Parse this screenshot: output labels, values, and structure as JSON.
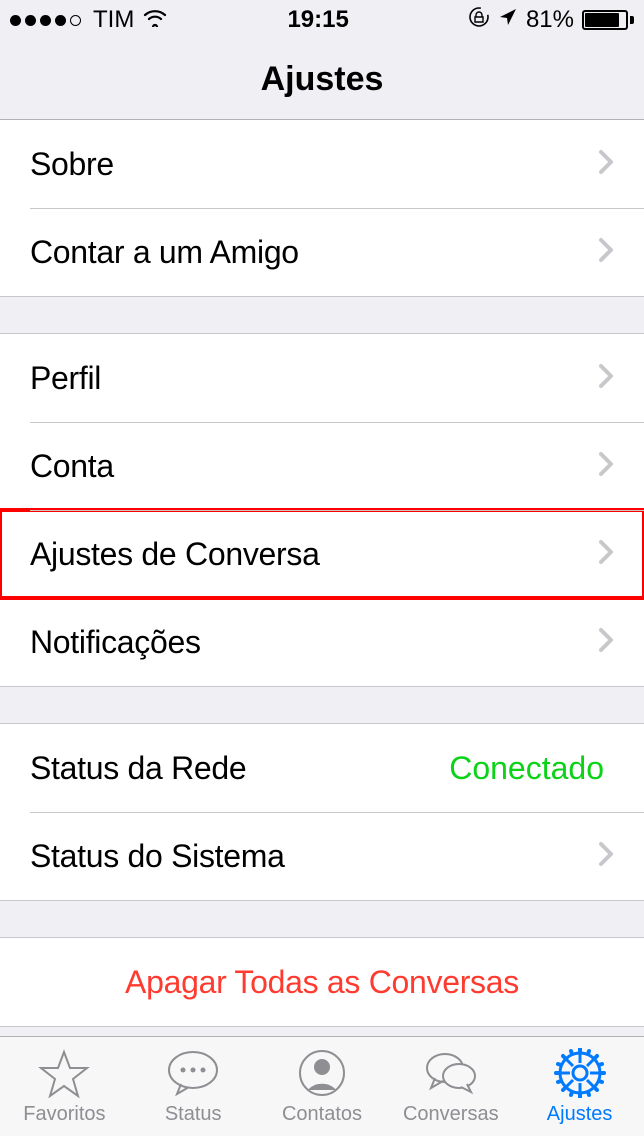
{
  "status_bar": {
    "carrier": "TIM",
    "time": "19:15",
    "battery_pct": "81%"
  },
  "nav": {
    "title": "Ajustes"
  },
  "groups": [
    {
      "rows": [
        {
          "id": "sobre",
          "label": "Sobre",
          "chevron": true
        },
        {
          "id": "contar-amigo",
          "label": "Contar a um Amigo",
          "chevron": true
        }
      ]
    },
    {
      "rows": [
        {
          "id": "perfil",
          "label": "Perfil",
          "chevron": true
        },
        {
          "id": "conta",
          "label": "Conta",
          "chevron": true
        },
        {
          "id": "ajustes-conversa",
          "label": "Ajustes de Conversa",
          "chevron": true,
          "highlight": true
        },
        {
          "id": "notificacoes",
          "label": "Notificações",
          "chevron": true
        }
      ]
    },
    {
      "rows": [
        {
          "id": "status-rede",
          "label": "Status da Rede",
          "value": "Conectado",
          "value_color": "green",
          "chevron": false
        },
        {
          "id": "status-sistema",
          "label": "Status do Sistema",
          "chevron": true
        }
      ]
    },
    {
      "rows": [
        {
          "id": "apagar-todas",
          "label": "Apagar Todas as Conversas",
          "centered": true,
          "destructive": true
        }
      ]
    }
  ],
  "tabs": [
    {
      "id": "favoritos",
      "label": "Favoritos",
      "icon": "star"
    },
    {
      "id": "status",
      "label": "Status",
      "icon": "bubble-dots"
    },
    {
      "id": "contatos",
      "label": "Contatos",
      "icon": "contact"
    },
    {
      "id": "conversas",
      "label": "Conversas",
      "icon": "bubbles"
    },
    {
      "id": "ajustes",
      "label": "Ajustes",
      "icon": "gear",
      "active": true
    }
  ]
}
